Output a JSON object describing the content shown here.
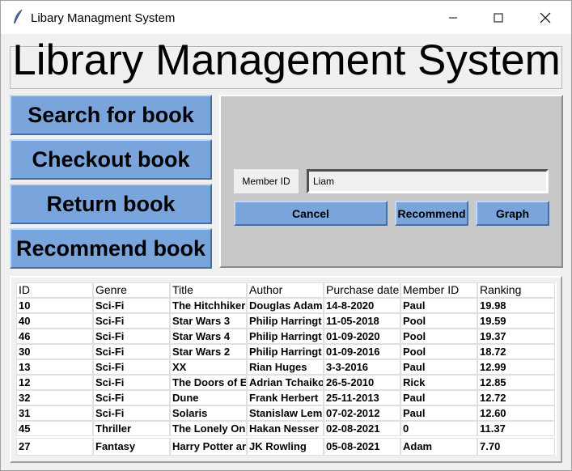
{
  "window": {
    "title": "Libary Managment System",
    "controls": {
      "minimize": "—",
      "maximize": "☐",
      "close": "✕"
    }
  },
  "header": {
    "title": "Library Management System"
  },
  "menu": {
    "search": "Search for book",
    "checkout": "Checkout book",
    "return": "Return book",
    "recommend": "Recommend book"
  },
  "form": {
    "member_label": "Member ID",
    "member_value": "Liam",
    "cancel": "Cancel",
    "recommend": "Recommend",
    "graph": "Graph"
  },
  "table": {
    "columns": [
      "ID",
      "Genre",
      "Title",
      "Author",
      "Purchase date",
      "Member ID",
      "Ranking"
    ],
    "rows": [
      [
        "10",
        "Sci-Fi",
        "The Hitchhiker",
        "Douglas Adam",
        "14-8-2020",
        "Paul",
        "19.98"
      ],
      [
        "40",
        "Sci-Fi",
        "Star Wars 3",
        "Philip Harringt",
        "11-05-2018",
        "Pool",
        "19.59"
      ],
      [
        "46",
        "Sci-Fi",
        "Star Wars 4",
        "Philip Harringt",
        "01-09-2020",
        "Pool",
        "19.37"
      ],
      [
        "30",
        "Sci-Fi",
        "Star Wars 2",
        "Philip Harringt",
        "01-09-2016",
        "Pool",
        "18.72"
      ],
      [
        "13",
        "Sci-Fi",
        "XX",
        "Rian Huges",
        "3-3-2016",
        "Paul",
        "12.99"
      ],
      [
        "12",
        "Sci-Fi",
        "The Doors of E",
        "Adrian Tchaiko",
        "26-5-2010",
        "Rick",
        "12.85"
      ],
      [
        "32",
        "Sci-Fi",
        "Dune",
        "Frank Herbert",
        "25-11-2013",
        "Paul",
        "12.72"
      ],
      [
        "31",
        "Sci-Fi",
        "Solaris",
        "Stanislaw Lem",
        "07-02-2012",
        "Paul",
        "12.60"
      ],
      [
        "45",
        "Thriller",
        "The Lonely On",
        "Hakan Nesser",
        "02-08-2021",
        "0",
        "11.37"
      ],
      [
        "27",
        "Fantasy",
        "Harry Potter ar",
        "JK Rowling",
        "05-08-2021",
        "Adam",
        "7.70"
      ]
    ]
  },
  "colors": {
    "button": "#7aa5dc",
    "panel": "#c8c8c8",
    "window_bg": "#f0f0f0"
  }
}
